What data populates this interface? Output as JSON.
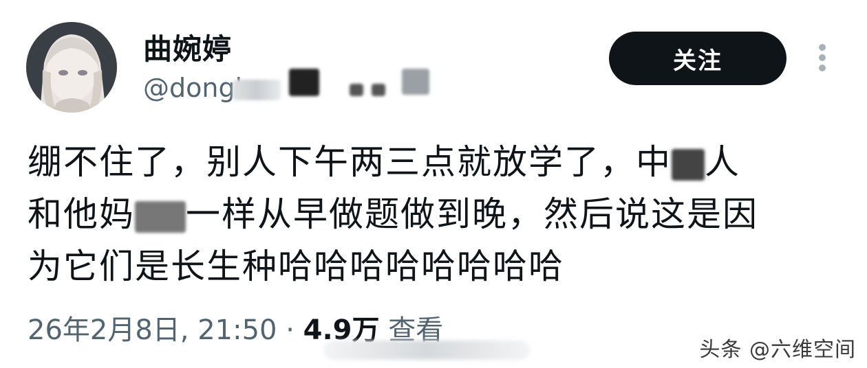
{
  "user": {
    "display_name": "曲婉婷",
    "handle_visible": "@dongh",
    "avatar_icon": "anime-girl-avatar"
  },
  "header": {
    "follow_label": "关注",
    "more_icon": "more-options-vertical-icon"
  },
  "tweet": {
    "lines": [
      "绷不住了，别人下午两三点就放学了，中",
      "人",
      "和他妈",
      "一样从早做题做到晚，然后说这是因",
      "为它们是长生种哈哈哈哈哈哈哈哈"
    ]
  },
  "meta": {
    "date_time": "26年2月8日, 21:50 · ",
    "view_count": "4.9万",
    "view_label": " 查看"
  },
  "watermark": "头条 @六维空间",
  "colors": {
    "text": "#0f1419",
    "secondary": "#536471",
    "button_bg": "#0f1419",
    "button_text": "#ffffff"
  }
}
